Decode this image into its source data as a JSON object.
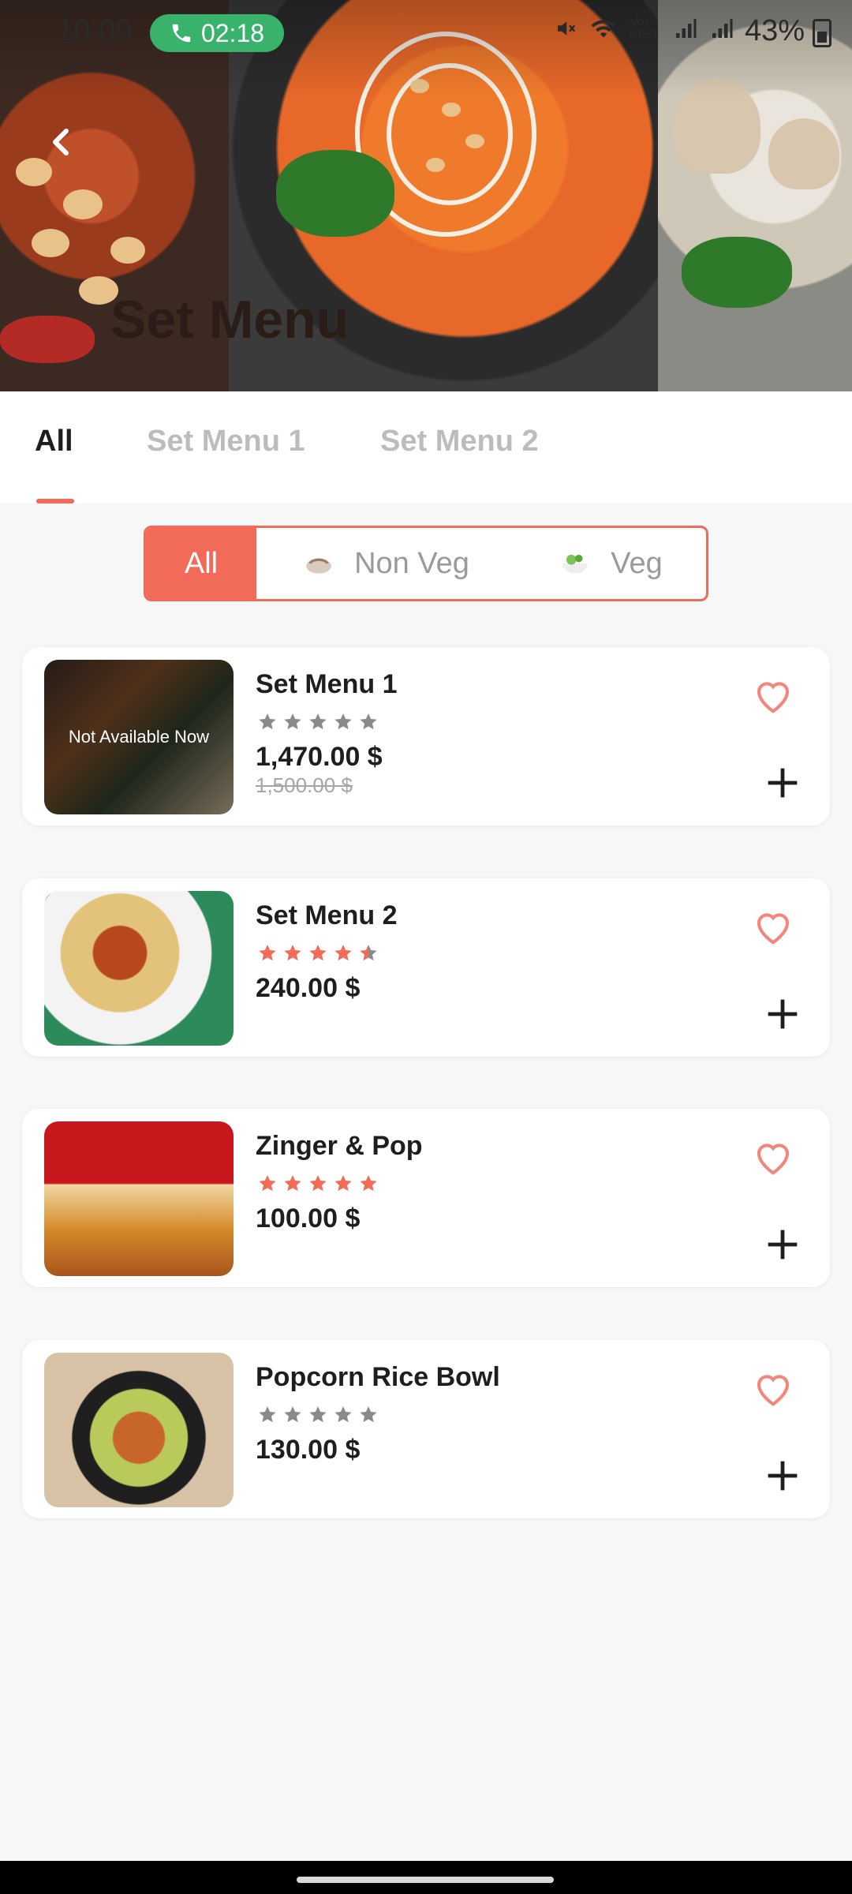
{
  "status": {
    "time": "10:09",
    "call_time": "02:18",
    "battery": "43%",
    "network": "Vo) LTE1"
  },
  "header": {
    "title": "Set Menu"
  },
  "tabs": [
    {
      "label": "All"
    },
    {
      "label": "Set Menu 1"
    },
    {
      "label": "Set Menu 2"
    }
  ],
  "filter": {
    "all": "All",
    "nonveg": "Non Veg",
    "veg": "Veg"
  },
  "items": [
    {
      "name": "Set Menu 1",
      "rating": 0,
      "price": "1,470.00 $",
      "old_price": "1,500.00 $",
      "availability": "Not Available Now"
    },
    {
      "name": "Set Menu 2",
      "rating": 4.5,
      "price": "240.00 $"
    },
    {
      "name": "Zinger & Pop",
      "rating": 5,
      "price": "100.00 $"
    },
    {
      "name": "Popcorn Rice Bowl",
      "rating": 0,
      "price": "130.00 $"
    }
  ],
  "colors": {
    "accent": "#F26A58",
    "star_empty": "#8A8A8A",
    "text": "#1E1E1E"
  },
  "icons": {
    "back": "chevron-left-icon",
    "favorite": "heart-outline-icon",
    "add": "plus-icon"
  }
}
